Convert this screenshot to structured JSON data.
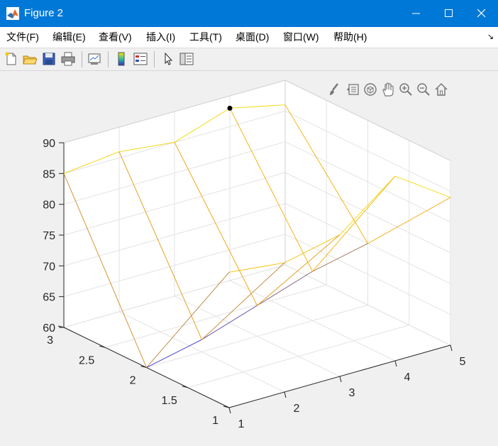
{
  "window": {
    "title": "Figure 2",
    "minimize": "—",
    "maximize": "☐",
    "close": "✕"
  },
  "menu": [
    {
      "label": "文件(F)"
    },
    {
      "label": "编辑(E)"
    },
    {
      "label": "查看(V)"
    },
    {
      "label": "插入(I)"
    },
    {
      "label": "工具(T)"
    },
    {
      "label": "桌面(D)"
    },
    {
      "label": "窗口(W)"
    },
    {
      "label": "帮助(H)"
    }
  ],
  "toolbar": [
    "new-figure-icon",
    "open-file-icon",
    "save-icon",
    "print-icon",
    "link-plot-icon",
    "colorbar-icon",
    "legend-icon",
    "pointer-icon",
    "property-inspector-icon"
  ],
  "axes_toolbar": [
    "brush-icon",
    "data-tips-icon",
    "rotate-3d-icon",
    "pan-icon",
    "zoom-in-icon",
    "zoom-out-icon",
    "home-icon"
  ],
  "chart_data": {
    "type": "mesh",
    "x_ticks": [
      "1",
      "2",
      "3",
      "4",
      "5"
    ],
    "y_ticks": [
      "1",
      "1.5",
      "2",
      "2.5",
      "3"
    ],
    "z_ticks": [
      "60",
      "65",
      "70",
      "75",
      "80",
      "85",
      "90"
    ],
    "xlim": [
      1,
      5
    ],
    "ylim": [
      1,
      3
    ],
    "zlim": [
      60,
      90
    ],
    "grid": true,
    "x": [
      1,
      2,
      3,
      4,
      5
    ],
    "y": [
      1,
      2,
      3
    ],
    "z": [
      [
        82,
        81,
        83,
        90,
        84
      ],
      [
        60,
        62,
        65,
        68,
        70
      ],
      [
        85,
        86,
        85,
        88,
        86
      ]
    ],
    "marker": {
      "x": 4,
      "y": 3,
      "z": 88,
      "color": "#000000"
    },
    "colors": {
      "low": "#2a2ad8",
      "mid": "#f0a000",
      "high": "#f5e600"
    }
  }
}
